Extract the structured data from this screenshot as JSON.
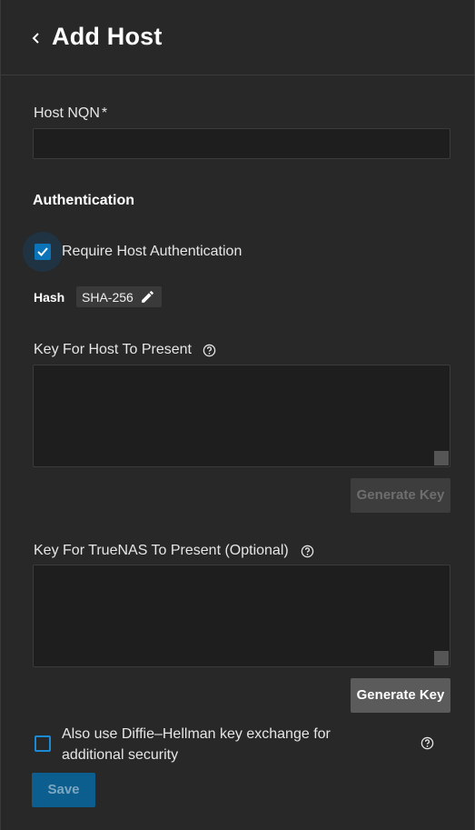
{
  "header": {
    "title": "Add Host",
    "back_icon": "chevron-left-icon"
  },
  "host_nqn": {
    "label": "Host NQN",
    "required_mark": "*",
    "value": "",
    "placeholder": ""
  },
  "authentication": {
    "section_title": "Authentication",
    "require_auth": {
      "label": "Require Host Authentication",
      "checked": true
    },
    "hash": {
      "label": "Hash",
      "value": "SHA-256",
      "edit_icon": "pencil-icon"
    },
    "host_key": {
      "label": "Key For Host To Present",
      "value": "",
      "help_icon": "help-circle-icon",
      "generate_label": "Generate Key",
      "generate_enabled": false
    },
    "truenas_key": {
      "label": "Key For TrueNAS To Present (Optional)",
      "value": "",
      "help_icon": "help-circle-icon",
      "generate_label": "Generate Key",
      "generate_enabled": true
    },
    "diffie_hellman": {
      "label": "Also use Diffie–Hellman key exchange for additional security",
      "checked": false,
      "help_icon": "help-circle-icon"
    }
  },
  "save": {
    "label": "Save",
    "enabled": false
  },
  "colors": {
    "accent": "#0b74b8",
    "background": "#282828",
    "input_bg": "#1e1e1e"
  }
}
